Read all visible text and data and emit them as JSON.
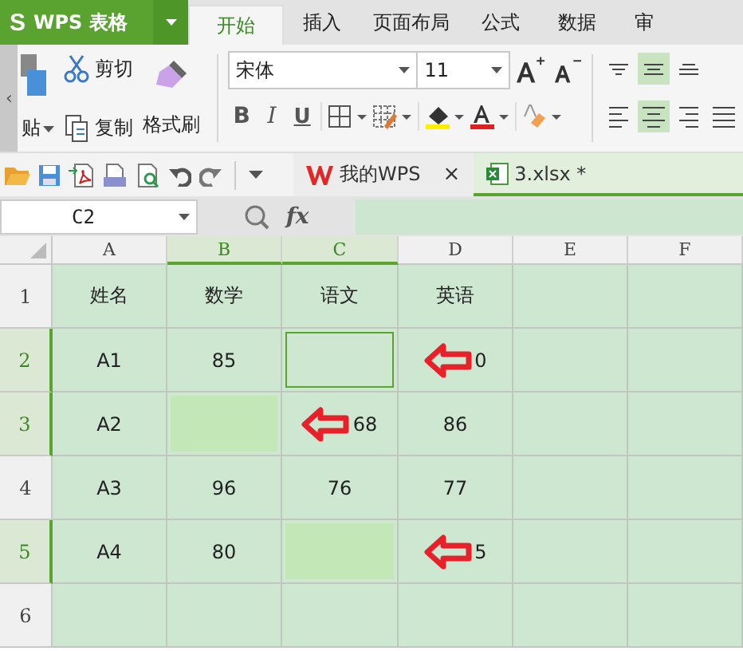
{
  "app": {
    "logo": "S",
    "name": "WPS 表格"
  },
  "tabs": [
    {
      "label": "开始",
      "selected": true
    },
    {
      "label": "插入",
      "selected": false
    },
    {
      "label": "页面布局",
      "selected": false
    },
    {
      "label": "公式",
      "selected": false
    },
    {
      "label": "数据",
      "selected": false
    },
    {
      "label": "审",
      "selected": false
    }
  ],
  "collapse": "‹",
  "clipboard": {
    "paste": "贴",
    "cut": "剪切",
    "copy": "复制",
    "format_painter": "格式刷"
  },
  "font": {
    "name": "宋体",
    "size": "11",
    "bold": "B",
    "italic": "I",
    "underline": "U"
  },
  "align_top": [
    {
      "kind": "top",
      "selected": false
    },
    {
      "kind": "middle",
      "selected": true
    },
    {
      "kind": "bottom",
      "selected": false
    }
  ],
  "align_bottom": [
    {
      "kind": "left",
      "selected": false
    },
    {
      "kind": "center",
      "selected": true
    },
    {
      "kind": "right",
      "selected": false
    },
    {
      "kind": "justify",
      "selected": false
    }
  ],
  "doc_tabs": [
    {
      "label": "我的WPS",
      "selected": false,
      "close": "×"
    },
    {
      "label": "3.xlsx *",
      "selected": true
    }
  ],
  "formula_bar": {
    "name_box": "C2",
    "fx": "fx"
  },
  "columns": [
    {
      "label": "A",
      "selected": false
    },
    {
      "label": "B",
      "selected": true
    },
    {
      "label": "C",
      "selected": true
    },
    {
      "label": "D",
      "selected": false
    },
    {
      "label": "E",
      "selected": false
    },
    {
      "label": "F",
      "selected": false
    }
  ],
  "rows": [
    {
      "label": "1",
      "selected": false,
      "cells": [
        {
          "kind": "plain",
          "text": "姓名"
        },
        {
          "kind": "plain",
          "text": "数学"
        },
        {
          "kind": "plain",
          "text": "语文"
        },
        {
          "kind": "plain",
          "text": "英语"
        },
        {
          "kind": "plain"
        },
        {
          "kind": "plain"
        }
      ]
    },
    {
      "label": "2",
      "selected": true,
      "cells": [
        {
          "kind": "plain",
          "text": "A1"
        },
        {
          "kind": "plain",
          "text": "85"
        },
        {
          "kind": "active"
        },
        {
          "kind": "arrow",
          "text": "0"
        },
        {
          "kind": "plain"
        },
        {
          "kind": "plain"
        }
      ]
    },
    {
      "label": "3",
      "selected": true,
      "cells": [
        {
          "kind": "plain",
          "text": "A2"
        },
        {
          "kind": "highlight"
        },
        {
          "kind": "arrow",
          "text": "68"
        },
        {
          "kind": "plain",
          "text": "86"
        },
        {
          "kind": "plain"
        },
        {
          "kind": "plain"
        }
      ]
    },
    {
      "label": "4",
      "selected": false,
      "cells": [
        {
          "kind": "plain",
          "text": "A3"
        },
        {
          "kind": "plain",
          "text": "96"
        },
        {
          "kind": "plain",
          "text": "76"
        },
        {
          "kind": "plain",
          "text": "77"
        },
        {
          "kind": "plain"
        },
        {
          "kind": "plain"
        }
      ]
    },
    {
      "label": "5",
      "selected": true,
      "cells": [
        {
          "kind": "plain",
          "text": "A4"
        },
        {
          "kind": "plain",
          "text": "80"
        },
        {
          "kind": "highlight"
        },
        {
          "kind": "arrow",
          "text": "5"
        },
        {
          "kind": "plain"
        },
        {
          "kind": "plain"
        }
      ]
    },
    {
      "label": "6",
      "selected": false,
      "cells": [
        {
          "kind": "plain"
        },
        {
          "kind": "plain"
        },
        {
          "kind": "plain"
        },
        {
          "kind": "plain"
        },
        {
          "kind": "plain"
        },
        {
          "kind": "plain"
        }
      ]
    }
  ]
}
